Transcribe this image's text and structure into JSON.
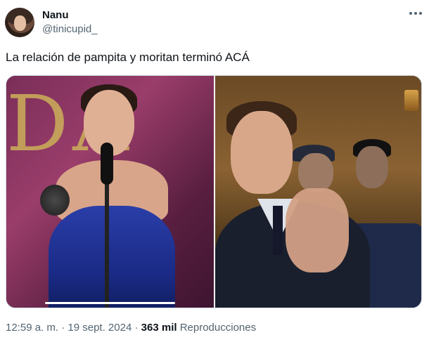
{
  "author": {
    "name": "Nanu",
    "handle": "@tinicupid_"
  },
  "tweet": {
    "text": "La relación de pampita y moritan terminó ACÁ"
  },
  "media": {
    "left_image": "photo-woman-award",
    "right_image": "photo-man-applauding"
  },
  "meta": {
    "time": "12:59 a. m.",
    "separator": " · ",
    "date": "19 sept. 2024",
    "views_count": "363 mil",
    "views_label": "Reproducciones"
  },
  "icons": {
    "more": "more-icon"
  }
}
